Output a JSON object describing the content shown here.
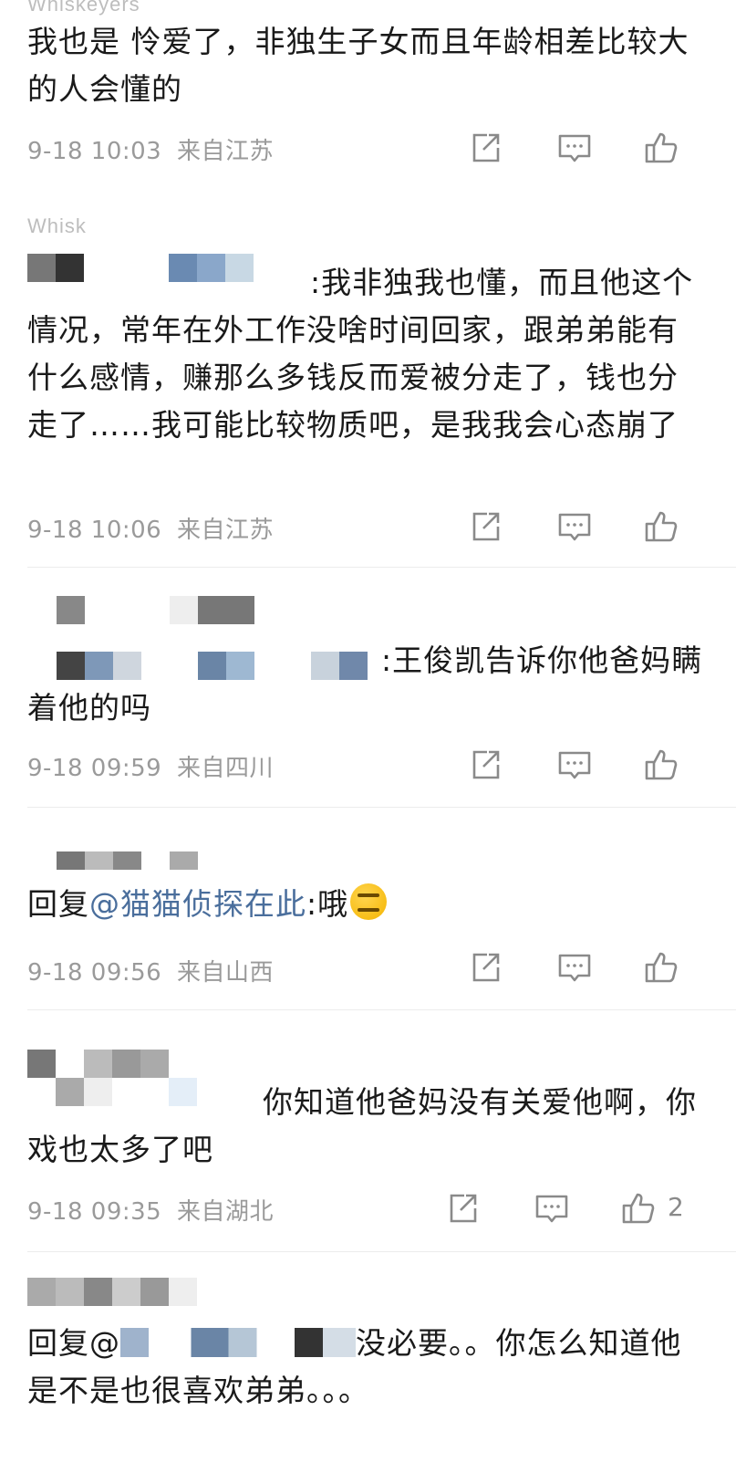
{
  "comments": [
    {
      "username_partial": "Whiskeyers",
      "text_pre": "我也是 怜爱了，非独生子女而且年龄相差比较大的人会懂的",
      "time": "9-18 10:03",
      "location": "来自江苏",
      "likes": ""
    },
    {
      "username_partial": "Whisk",
      "text_pre": ":我非独我也懂，而且他这个情况，常年在外工作没啥时间回家，跟弟弟能有什么感情，赚那么多钱反而爱被分走了，钱也分走了……我可能比较物质吧，是我我会心态崩了",
      "time": "9-18 10:06",
      "location": "来自江苏",
      "likes": ""
    },
    {
      "text_pre": ":王俊凯告诉你他爸妈瞒着他的吗",
      "time": "9-18 09:59",
      "location": "来自四川",
      "likes": ""
    },
    {
      "text_pre": "回复",
      "mention": "@猫猫侦探在此",
      "text_post": ":哦",
      "time": "9-18 09:56",
      "location": "来自山西",
      "likes": ""
    },
    {
      "text_pre": "你知道他爸妈没有关爱他啊，你戏也太多了吧",
      "time": "9-18 09:35",
      "location": "来自湖北",
      "likes": "2"
    },
    {
      "text_pre": "回复@",
      "text_post": "没必要。。你怎么知道他是不是也很喜欢弟弟。。。"
    }
  ],
  "icons": [
    "share-icon",
    "comment-icon",
    "like-icon"
  ],
  "colors": {
    "text": "#1a1a1a",
    "meta": "#9a9a9a",
    "mention": "#4a6e9c",
    "icon": "#8a8a8a"
  }
}
